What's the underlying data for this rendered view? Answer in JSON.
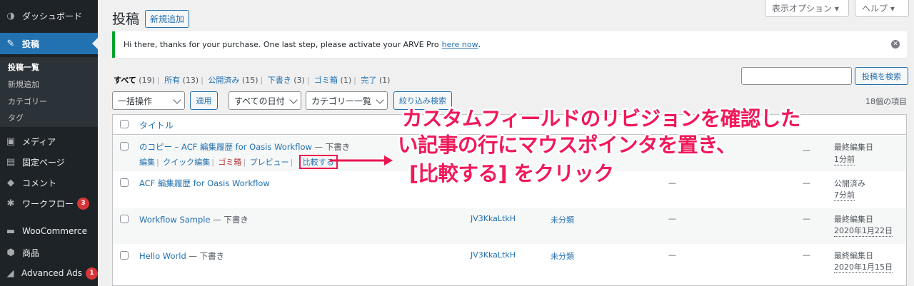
{
  "sidebar": {
    "items": [
      {
        "label": "ダッシュボード",
        "icon": "dashboard-icon",
        "glyph": "◑"
      },
      {
        "label": "投稿",
        "icon": "pin-icon",
        "glyph": "✎"
      },
      {
        "label": "メディア",
        "icon": "media-icon",
        "glyph": "▣"
      },
      {
        "label": "固定ページ",
        "icon": "page-icon",
        "glyph": "▤"
      },
      {
        "label": "コメント",
        "icon": "comment-icon",
        "glyph": "◆"
      },
      {
        "label": "ワークフロー",
        "icon": "gear-icon",
        "glyph": "✱",
        "badge": "3"
      },
      {
        "label": "WooCommerce",
        "icon": "woocommerce-icon",
        "glyph": "▬"
      },
      {
        "label": "商品",
        "icon": "box-icon",
        "glyph": "⬢"
      },
      {
        "label": "Advanced Ads",
        "icon": "chart-icon",
        "glyph": "◢",
        "badge": "1"
      }
    ],
    "submenu": [
      "投稿一覧",
      "新規追加",
      "カテゴリー",
      "タグ"
    ]
  },
  "top": {
    "screen_options": "表示オプション ▾",
    "help": "ヘルプ ▾"
  },
  "page": {
    "title": "投稿",
    "add_new": "新規追加"
  },
  "notice": {
    "text": "Hi there, thanks for your purchase. One last step, please activate your ARVE Pro",
    "link": "here now",
    "tail": ".",
    "dismiss": "✕"
  },
  "views": [
    {
      "label": "すべて",
      "count": "(19)"
    },
    {
      "label": "所有",
      "count": "(13)"
    },
    {
      "label": "公開済み",
      "count": "(15)"
    },
    {
      "label": "下書き",
      "count": "(3)"
    },
    {
      "label": "ゴミ箱",
      "count": "(1)"
    },
    {
      "label": "完了",
      "count": "(1)"
    }
  ],
  "search": {
    "button": "投稿を検索",
    "value": ""
  },
  "filters": {
    "bulk": "一括操作",
    "apply": "適用",
    "dates": "すべての日付",
    "categories": "カテゴリー一覧",
    "filter": "絞り込み検索",
    "items_count": "18個の項目"
  },
  "table": {
    "header_title": "タイトル",
    "rows": [
      {
        "title": "のコピー – ACF 編集履歴 for Oasis Workflow",
        "state": " — 下書き",
        "author": "",
        "category": "",
        "tags": "—",
        "comments": "—",
        "date_status": "最終編集日",
        "date": "1分前",
        "actions": [
          "編集",
          "クイック編集",
          "ゴミ箱",
          "プレビュー",
          "比較する"
        ]
      },
      {
        "title": "ACF 編集履歴 for Oasis Workflow",
        "state": "",
        "author": "",
        "category": "",
        "tags": "—",
        "comments": "—",
        "date_status": "公開済み",
        "date": "7分前"
      },
      {
        "title": "Workflow Sample",
        "state": " — 下書き",
        "author": "JV3KkaLtkH",
        "category": "未分類",
        "tags": "—",
        "comments": "—",
        "date_status": "最終編集日",
        "date": "2020年1月22日"
      },
      {
        "title": "Hello World",
        "state": " — 下書き",
        "author": "JV3KkaLtkH",
        "category": "未分類",
        "tags": "—",
        "comments": "—",
        "date_status": "最終編集日",
        "date": "2020年1月15日"
      }
    ]
  },
  "annotation": {
    "line1": "カスタムフィールドのリビジョンを確認した",
    "line2": "い記事の行にマウスポインタを置き、",
    "line3": "[比較する] をクリック",
    "color": "#f0195a"
  }
}
